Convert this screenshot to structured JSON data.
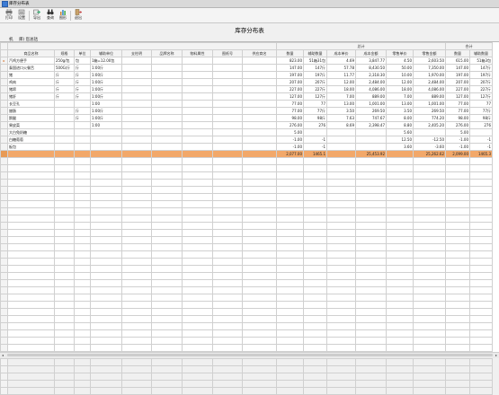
{
  "window": {
    "title": "库存分布表"
  },
  "toolbar": {
    "buttons": [
      {
        "label": "打印",
        "icon": "printer-icon"
      },
      {
        "label": "设置",
        "icon": "settings-icon"
      },
      {
        "label": "导出",
        "icon": "export-icon"
      },
      {
        "label": "查询",
        "icon": "binoculars-icon"
      },
      {
        "label": "图形",
        "icon": "chart-icon"
      },
      {
        "label": "退出",
        "icon": "exit-icon"
      }
    ]
  },
  "report": {
    "title": "库存分布表"
  },
  "filter": {
    "warehouse_label": "机",
    "scope_label": "库) 您总括"
  },
  "table": {
    "group_headers": {
      "ledger": "总计",
      "summary": "合计"
    },
    "columns": [
      "商品名称",
      "规格",
      "单位",
      "辅助单位",
      "支柱明",
      "品牌名称",
      "物料属性",
      "图纸号",
      "供应商名",
      "数量",
      "辅助数量",
      "成本单价",
      "成本金额",
      "零售单价",
      "零售金额",
      "数量",
      "辅助数量"
    ],
    "rows": [
      [
        "汽鸡方便手",
        "250g/包",
        "包",
        "1箱=12.00包",
        "",
        "",
        "",
        "",
        "",
        "823.00",
        "51箱31包",
        "4.69",
        "3,847.77",
        "4.50",
        "2,603.50",
        "615.00",
        "51箱3包"
      ],
      [
        "泰国进口火餐舌",
        "500G/斤",
        "斤",
        "1:00斤",
        "",
        "",
        "",
        "",
        "",
        "147.00",
        "147斤",
        "57.78",
        "8,430.50",
        "50.00",
        "7,350.00",
        "147.00",
        "147斤"
      ],
      [
        "猪",
        "斤",
        "斤",
        "1:00斤",
        "",
        "",
        "",
        "",
        "",
        "197.00",
        "197斤",
        "11.77",
        "2,318.30",
        "10.00",
        "1,970.00",
        "197.00",
        "197斤"
      ],
      [
        "鸡肉",
        "斤",
        "斤",
        "1:00斤",
        "",
        "",
        "",
        "",
        "",
        "207.00",
        "207斤",
        "12.00",
        "2,484.00",
        "12.00",
        "2,484.00",
        "207.00",
        "207斤"
      ],
      [
        "猪蹄",
        "斤",
        "斤",
        "1:00斤",
        "",
        "",
        "",
        "",
        "",
        "227.00",
        "227斤",
        "18.00",
        "4,086.00",
        "18.00",
        "4,086.00",
        "227.00",
        "227斤"
      ],
      [
        "猪肝",
        "斤",
        "斤",
        "1:00斤",
        "",
        "",
        "",
        "",
        "",
        "127.00",
        "127斤",
        "7.00",
        "889.00",
        "7.00",
        "889.00",
        "127.00",
        "127斤"
      ],
      [
        "长豆孔",
        "",
        "",
        "1:00",
        "",
        "",
        "",
        "",
        "",
        "77.00",
        "77",
        "13.00",
        "1,001.00",
        "13.00",
        "1,001.00",
        "77.00",
        "77"
      ],
      [
        "腊肠",
        "",
        "斤",
        "1:00斤",
        "",
        "",
        "",
        "",
        "",
        "77.00",
        "77斤",
        "3.50",
        "269.50",
        "3.50",
        "269.50",
        "77.00",
        "77斤"
      ],
      [
        "鹅腿",
        "",
        "斤",
        "1:00斤",
        "",
        "",
        "",
        "",
        "",
        "98.00",
        "98斤",
        "7.63",
        "747.67",
        "8.00",
        "774.20",
        "98.00",
        "98斤"
      ],
      [
        "果皮菜",
        "",
        "",
        "1:00",
        "",
        "",
        "",
        "",
        "",
        "276.00",
        "276",
        "8.69",
        "2,398.47",
        "8.80",
        "2,405.20",
        "276.00",
        "276"
      ],
      [
        "大白兔奶糖",
        "",
        "",
        "",
        "",
        "",
        "",
        "",
        "",
        "5.00",
        "",
        "",
        "",
        "5.60",
        "",
        "5.00",
        ""
      ],
      [
        "白糖葡萄",
        "",
        "",
        "",
        "",
        "",
        "",
        "",
        "",
        "-1.00",
        "-1",
        "",
        "",
        "12.50",
        "-12.50",
        "-1.00",
        "-1"
      ],
      [
        "板包",
        "",
        "",
        "",
        "",
        "",
        "",
        "",
        "",
        "-1.00",
        "-1",
        "",
        "",
        "3.60",
        "-3.60",
        "-1.00",
        "-1"
      ]
    ],
    "total": [
      "",
      "",
      "",
      "",
      "",
      "",
      "",
      "",
      "",
      "2,077.00",
      "1465.1",
      "",
      "25,453.92",
      "",
      "25,262.62",
      "2,099.00",
      "1465.3"
    ]
  },
  "colors": {
    "total_row": "#f2a86a",
    "grid_line": "#d0d0d0"
  }
}
